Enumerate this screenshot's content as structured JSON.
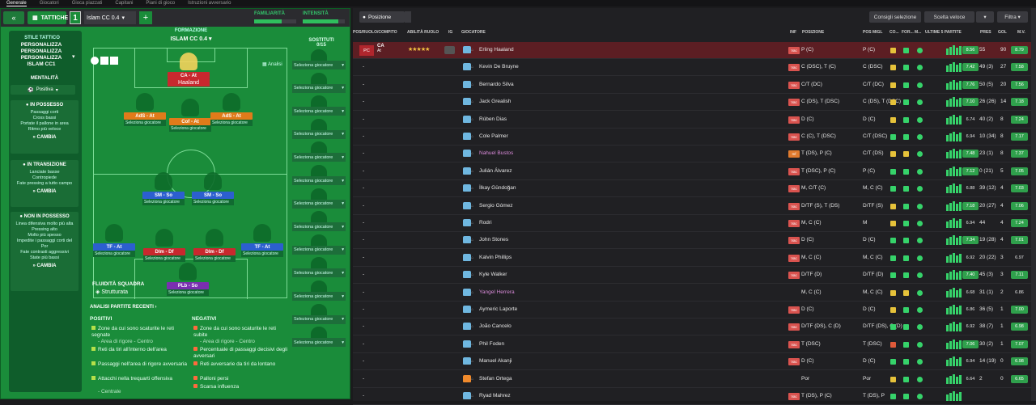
{
  "topnav": [
    "Generale",
    "Giocatori",
    "Gioca piazzati",
    "Capitani",
    "Piani di gioco",
    "Istruzioni avversario"
  ],
  "left": {
    "tab_label": "TATTICHE",
    "tactic_num": "1",
    "tactic_name": "Islam CC 0.4",
    "familiarity_label": "FAMILIARITÀ",
    "intensity_label": "INTENSITÀ",
    "familiarity_fill": 0.66,
    "intensity_fill": 0.85,
    "style_label": "STILE TATTICO",
    "style_lines": [
      "PERSONALIZZA",
      "PERSONALIZZA",
      "PERSONALIZZA",
      "ISLAM CC1"
    ],
    "mentality_label": "MENTALITÀ",
    "mentality_value": "Positiva",
    "possesso": {
      "title": "IN POSSESSO",
      "items": [
        "Passaggi corti",
        "Cross bassi",
        "Portate il pallone in area",
        "Ritmo più veloce"
      ],
      "cambia": "CAMBIA"
    },
    "transizione": {
      "title": "IN TRANSIZIONE",
      "items": [
        "Lanciate basse",
        "Contropiede",
        "Fate pressing a tutto campo"
      ],
      "cambia": "CAMBIA"
    },
    "nonpossesso": {
      "title": "NON IN POSSESSO",
      "items": [
        "Linea difensiva molto più alta",
        "Pressing alto",
        "Molto più spesso",
        "Impedite i passaggi corti del Por",
        "Fate contrasti aggressivi",
        "State più bassi"
      ],
      "cambia": "CAMBIA"
    },
    "formation_label": "FORMAZIONE",
    "formation_name": "ISLAM CC 0.4",
    "analisi": "Analisi",
    "positions": [
      {
        "role": "CA - At",
        "player": "Haaland",
        "color": "#c8282e"
      },
      {
        "role": "AdS - At",
        "player": "Seleziona giocatore",
        "color": "#e07b1a"
      },
      {
        "role": "Cof - At",
        "player": "Seleziona giocatore",
        "color": "#e07b1a"
      },
      {
        "role": "AdS - At",
        "player": "Seleziona giocatore",
        "color": "#e07b1a"
      },
      {
        "role": "SM - So",
        "player": "Seleziona giocatore",
        "color": "#2c5fcf"
      },
      {
        "role": "SM - So",
        "player": "Seleziona giocatore",
        "color": "#2c5fcf"
      },
      {
        "role": "TF - At",
        "player": "Seleziona giocatore",
        "color": "#2c5fcf"
      },
      {
        "role": "Dlm - Df",
        "player": "Seleziona giocatore",
        "color": "#c8282e"
      },
      {
        "role": "Dlm - Df",
        "player": "Seleziona giocatore",
        "color": "#c8282e"
      },
      {
        "role": "TF - At",
        "player": "Seleziona giocatore",
        "color": "#2c5fcf"
      },
      {
        "role": "PLb - So",
        "player": "Seleziona giocatore",
        "color": "#7a2fb0"
      }
    ],
    "fluidity_label": "FLUIDITÀ SQUADRA",
    "fluidity_value": "Strutturata",
    "subs_label": "SOSTITUTI",
    "subs_count": "0/15",
    "sub_placeholder": "Seleziona giocatore",
    "analysis_title": "ANALISI PARTITE RECENTI",
    "pos_title": "POSITIVI",
    "neg_title": "NEGATIVI",
    "positives": [
      {
        "text": "Zone da cui sono scaturite le reti segnate",
        "sub": "- Area di rigore - Centro"
      },
      {
        "text": "Reti da tiri all'interno dell'area",
        "sub": ""
      },
      {
        "text": "Passaggi nell'area di rigore avversaria",
        "sub": ""
      },
      {
        "text": "Attacchi nella trequarti offensiva",
        "sub": "- Centrale"
      }
    ],
    "negatives": [
      {
        "text": "Zone da cui sono scaturite le reti subite",
        "sub": "- Area di rigore - Centro"
      },
      {
        "text": "Percentuale di passaggi decisivi degli avversari",
        "sub": ""
      },
      {
        "text": "Reti avversarie da tiri da lontano",
        "sub": ""
      },
      {
        "text": "Palloni persi",
        "sub": ""
      },
      {
        "text": "Scarsa influenza",
        "sub": ""
      }
    ]
  },
  "right": {
    "filter_label": "Posizione",
    "consigli": "Consigli selezione",
    "scelta": "Scelta veloce",
    "filtra": "Filtra",
    "headers": [
      "POS/RUOLO/COMPITO",
      "ABILITÀ RUOLO",
      "IG",
      "GIOCATORE",
      "INF",
      "POSIZIONE",
      "POS MIGL",
      "CO...",
      "FOR...",
      "M...",
      "ULTIME 5 PARTITE",
      "PRES",
      "GOL",
      "M.V."
    ],
    "rows": [
      {
        "pos": "PC",
        "role": "CA",
        "task": "At",
        "stars": "★★★★★",
        "name": "Erling Haaland",
        "inf": "Vac",
        "posizione": "P (C)",
        "best": "P (C)",
        "rating": "8.56",
        "pres": "55",
        "gol": "90",
        "mv": "8.79",
        "sel": true,
        "c1": "y",
        "c2": "g",
        "c3": "g"
      },
      {
        "name": "Kevin De Bruyne",
        "inf": "Vac",
        "posizione": "C (DSC), T (C)",
        "best": "C (DSC)",
        "rating": "7.42",
        "pres": "49 (3)",
        "gol": "27",
        "mv": "7.58",
        "c1": "y",
        "c2": "g",
        "c3": "g"
      },
      {
        "name": "Bernardo Silva",
        "inf": "Vac",
        "posizione": "C/T (DC)",
        "best": "C/T (DC)",
        "rating": "7.76",
        "pres": "50 (5)",
        "gol": "20",
        "mv": "7.56",
        "c1": "y",
        "c2": "g",
        "c3": "g"
      },
      {
        "name": "Jack Grealish",
        "inf": "Vac",
        "posizione": "C (DS), T (DSC)",
        "best": "C (DS), T (DSC)",
        "rating": "7.10",
        "pres": "26 (26)",
        "gol": "14",
        "mv": "7.18",
        "c1": "y",
        "c2": "g",
        "c3": "g"
      },
      {
        "name": "Rúben Dias",
        "inf": "Vac",
        "posizione": "D (C)",
        "best": "D (C)",
        "rating": "6.74",
        "pres": "40 (2)",
        "gol": "8",
        "mv": "7.24",
        "c1": "y",
        "c2": "g",
        "c3": "g",
        "plain": true
      },
      {
        "name": "Cole Palmer",
        "inf": "Vac",
        "posizione": "C (C), T (DSC)",
        "best": "C/T (DSC)",
        "rating": "6.94",
        "pres": "10 (34)",
        "gol": "8",
        "mv": "7.17",
        "c1": "g",
        "c2": "g",
        "c3": "g",
        "plain": true
      },
      {
        "name": "Nahuel Bustos",
        "inf": "Inf",
        "posizione": "T (DS), P (C)",
        "best": "C/T (DS)",
        "rating": "7.48",
        "pres": "23 (1)",
        "gol": "8",
        "mv": "7.37",
        "c1": "y",
        "c2": "y",
        "c3": "g",
        "pink": true,
        "infOrange": true
      },
      {
        "name": "Julián Álvarez",
        "inf": "Vac",
        "posizione": "T (DSC), P (C)",
        "best": "P (C)",
        "rating": "7.12",
        "pres": "0 (21)",
        "gol": "5",
        "mv": "7.05",
        "c1": "g",
        "c2": "g",
        "c3": "r"
      },
      {
        "name": "İlkay Gündoğan",
        "inf": "Vac",
        "posizione": "M, C/T (C)",
        "best": "M, C (C)",
        "rating": "6.88",
        "pres": "39 (12)",
        "gol": "4",
        "mv": "7.03",
        "c1": "g",
        "c2": "g",
        "c3": "g",
        "plain": true
      },
      {
        "name": "Sergio Gómez",
        "inf": "Vac",
        "posizione": "D/TF (S), T (DS)",
        "best": "D/TF (S)",
        "rating": "7.18",
        "pres": "20 (27)",
        "gol": "4",
        "mv": "7.06",
        "c1": "y",
        "c2": "g",
        "c3": "g"
      },
      {
        "name": "Rodri",
        "inf": "Vac",
        "posizione": "M, C (C)",
        "best": "M",
        "rating": "6.94",
        "pres": "44",
        "gol": "4",
        "mv": "7.24",
        "c1": "y",
        "c2": "g",
        "c3": "g",
        "plain": true
      },
      {
        "name": "John Stones",
        "inf": "Vac",
        "posizione": "D (C)",
        "best": "D (C)",
        "rating": "7.34",
        "pres": "19 (28)",
        "gol": "4",
        "mv": "7.01",
        "c1": "g",
        "c2": "g",
        "c3": "g"
      },
      {
        "name": "Kalvin Phillips",
        "inf": "Vac",
        "posizione": "M, C (C)",
        "best": "M, C (C)",
        "rating": "6.92",
        "pres": "20 (22)",
        "gol": "3",
        "mv": "6.97",
        "c1": "g",
        "c2": "g",
        "c3": "g",
        "plain": true,
        "mvplain": true
      },
      {
        "name": "Kyle Walker",
        "inf": "Vac",
        "posizione": "D/TF (D)",
        "best": "D/TF (D)",
        "rating": "7.40",
        "pres": "45 (3)",
        "gol": "3",
        "mv": "7.11",
        "c1": "g",
        "c2": "g",
        "c3": "g"
      },
      {
        "name": "Yangel Herrera",
        "inf": "",
        "posizione": "M, C (C)",
        "best": "M, C (C)",
        "rating": "6.68",
        "pres": "31 (1)",
        "gol": "2",
        "mv": "6.86",
        "c1": "y",
        "c2": "y",
        "c3": "g",
        "pink": true,
        "plain": true,
        "mvplain": true
      },
      {
        "name": "Aymeric Laporte",
        "inf": "Vac",
        "posizione": "D (C)",
        "best": "D (C)",
        "rating": "6.86",
        "pres": "36 (5)",
        "gol": "1",
        "mv": "7.00",
        "c1": "y",
        "c2": "g",
        "c3": "g",
        "plain": true
      },
      {
        "name": "João Cancelo",
        "inf": "Vac",
        "posizione": "D/TF (DS), C (D)",
        "best": "D/TF (DS), C (D)",
        "rating": "6.92",
        "pres": "38 (7)",
        "gol": "1",
        "mv": "6.98",
        "c1": "g",
        "c2": "g",
        "c3": "g",
        "plain": true
      },
      {
        "name": "Phil Foden",
        "inf": "Vac",
        "posizione": "T (DSC)",
        "best": "T (DSC)",
        "rating": "7.06",
        "pres": "30 (2)",
        "gol": "1",
        "mv": "7.07",
        "c1": "o",
        "c2": "g",
        "c3": "g"
      },
      {
        "name": "Manuel Akanji",
        "inf": "Vac",
        "posizione": "D (C)",
        "best": "D (C)",
        "rating": "6.94",
        "pres": "14 (19)",
        "gol": "0",
        "mv": "6.98",
        "c1": "g",
        "c2": "g",
        "c3": "g",
        "plain": true
      },
      {
        "name": "Stefan Ortega",
        "inf": "",
        "posizione": "Por",
        "best": "Por",
        "rating": "6.64",
        "pres": "2",
        "gol": "0",
        "mv": "6.65",
        "c1": "y",
        "c2": "g",
        "c3": "g",
        "plain": true,
        "gk": true
      },
      {
        "name": "Ryad Mahrez",
        "inf": "Vac",
        "posizione": "T (DS), P (C)",
        "best": "T (DS), P",
        "rating": "",
        "pres": "",
        "gol": "",
        "mv": "",
        "c1": "g",
        "c2": "g",
        "c3": "g",
        "plain": true
      }
    ]
  }
}
